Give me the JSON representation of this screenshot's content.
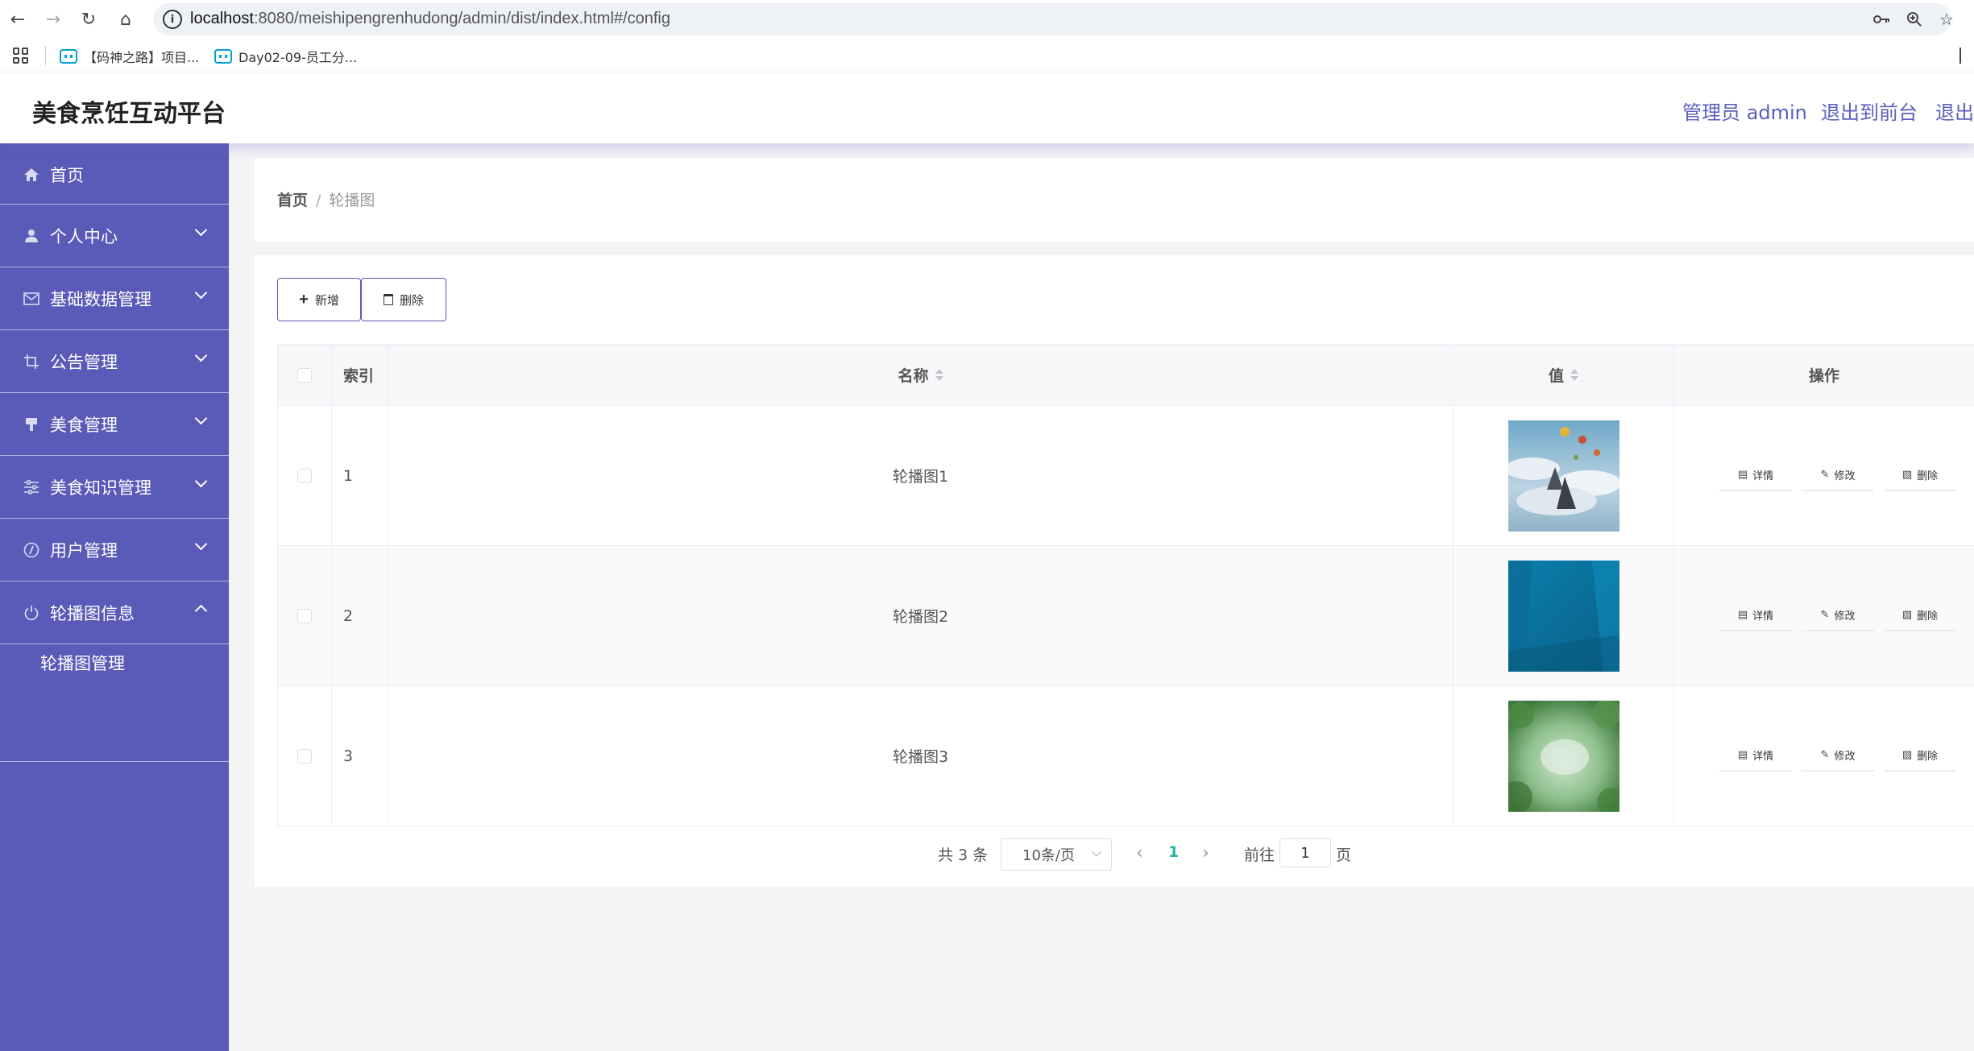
{
  "browser": {
    "url_host": "localhost",
    "url_rest": ":8080/meishipengrenhudong/admin/dist/index.html#/config",
    "bookmarks": [
      {
        "label": "【码神之路】项目..."
      },
      {
        "label": "Day02-09-员工分..."
      }
    ]
  },
  "header": {
    "title": "美食烹饪互动平台",
    "user_label": "管理员 admin",
    "front_link": "退出到前台",
    "logout_link": "退出登录"
  },
  "sidebar": {
    "home": {
      "label": "首页",
      "icon": "home-icon"
    },
    "items": [
      {
        "label": "个人中心",
        "icon": "user-icon",
        "expanded": false
      },
      {
        "label": "基础数据管理",
        "icon": "mail-icon",
        "expanded": false
      },
      {
        "label": "公告管理",
        "icon": "crop-icon",
        "expanded": false
      },
      {
        "label": "美食管理",
        "icon": "brush-icon",
        "expanded": false
      },
      {
        "label": "美食知识管理",
        "icon": "sliders-icon",
        "expanded": false
      },
      {
        "label": "用户管理",
        "icon": "compass-icon",
        "expanded": false
      },
      {
        "label": "轮播图信息",
        "icon": "power-icon",
        "expanded": true
      }
    ],
    "submenu": [
      {
        "label": "轮播图管理"
      }
    ]
  },
  "breadcrumb": {
    "home": "首页",
    "separator": "/",
    "current": "轮播图"
  },
  "toolbar": {
    "add_label": "新增",
    "delete_label": "删除"
  },
  "table": {
    "columns": {
      "index": "索引",
      "name": "名称",
      "value": "值",
      "ops": "操作"
    },
    "rows": [
      {
        "index": "1",
        "name": "轮播图1",
        "image": "sky-balloons"
      },
      {
        "index": "2",
        "name": "轮播图2",
        "image": "blue-abstract"
      },
      {
        "index": "3",
        "name": "轮播图3",
        "image": "green-forest"
      }
    ],
    "actions": {
      "detail": "详情",
      "edit": "修改",
      "delete": "删除"
    }
  },
  "pagination": {
    "total_text": "共 3 条",
    "page_size": "10条/页",
    "current_page": "1",
    "goto_label": "前往",
    "goto_value": "1",
    "goto_suffix": "页"
  },
  "colors": {
    "sidebar_bg": "#5a5ab9",
    "accent": "#5a5ebd",
    "page_active": "#2bb5a8"
  }
}
